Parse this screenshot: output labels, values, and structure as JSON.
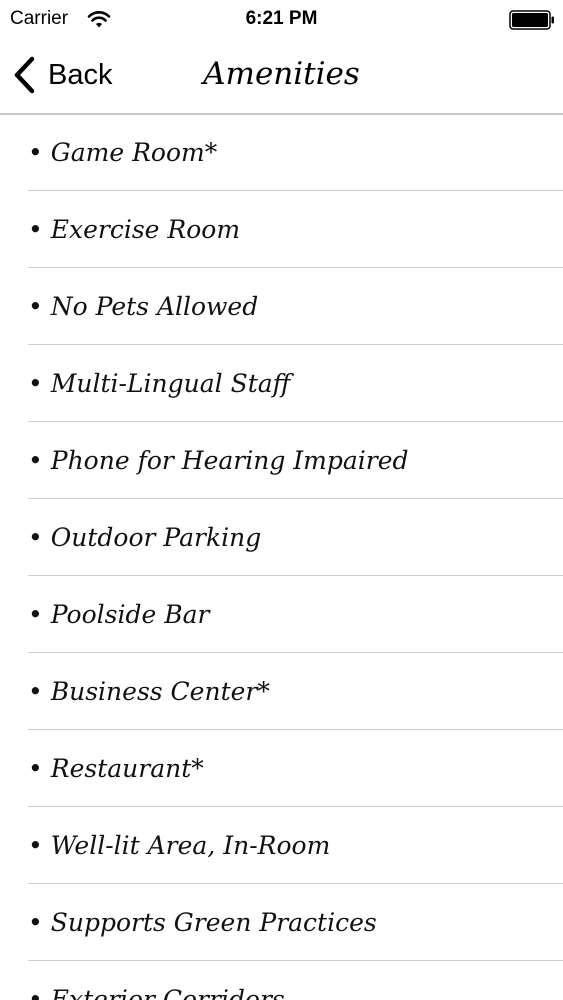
{
  "status_bar": {
    "carrier": "Carrier",
    "time": "6:21 PM"
  },
  "nav": {
    "back_label": "Back",
    "title": "Amenities"
  },
  "amenities": [
    "Game Room*",
    "Exercise Room",
    "No Pets Allowed",
    "Multi-Lingual Staff",
    "Phone for Hearing Impaired",
    "Outdoor Parking",
    "Poolside Bar",
    "Business Center*",
    "Restaurant*",
    "Well-lit Area, In-Room",
    "Supports Green Practices",
    "Exterior Corridors"
  ],
  "bullet": "•",
  "icons": {
    "wifi": "wifi-icon",
    "battery": "battery-icon",
    "back": "chevron-left-icon"
  }
}
